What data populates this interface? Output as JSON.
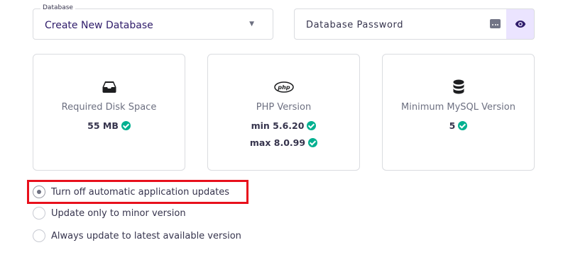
{
  "database_select": {
    "label": "Database",
    "value": "Create New Database",
    "caret_icon": "chevron-down-icon"
  },
  "password_field": {
    "placeholder": "Database Password",
    "generate_icon": "password-generator-icon",
    "toggle_icon": "eye-icon"
  },
  "cards": [
    {
      "icon": "inbox-tray-icon",
      "title": "Required Disk Space",
      "values": [
        "55 MB"
      ]
    },
    {
      "icon": "php-logo-icon",
      "title": "PHP Version",
      "values": [
        "min 5.6.20",
        "max 8.0.99"
      ]
    },
    {
      "icon": "database-icon",
      "title": "Minimum MySQL Version",
      "values": [
        "5"
      ]
    }
  ],
  "update_options": [
    {
      "label": "Turn off automatic application updates",
      "selected": true
    },
    {
      "label": "Update only to minor version",
      "selected": false
    },
    {
      "label": "Always update to latest available version",
      "selected": false
    }
  ],
  "colors": {
    "accent_bg": "#ebe4ff",
    "check_green": "#00b090",
    "highlight_red": "#e8101c",
    "text_dark": "#36344d",
    "text_muted": "#6d7081"
  }
}
